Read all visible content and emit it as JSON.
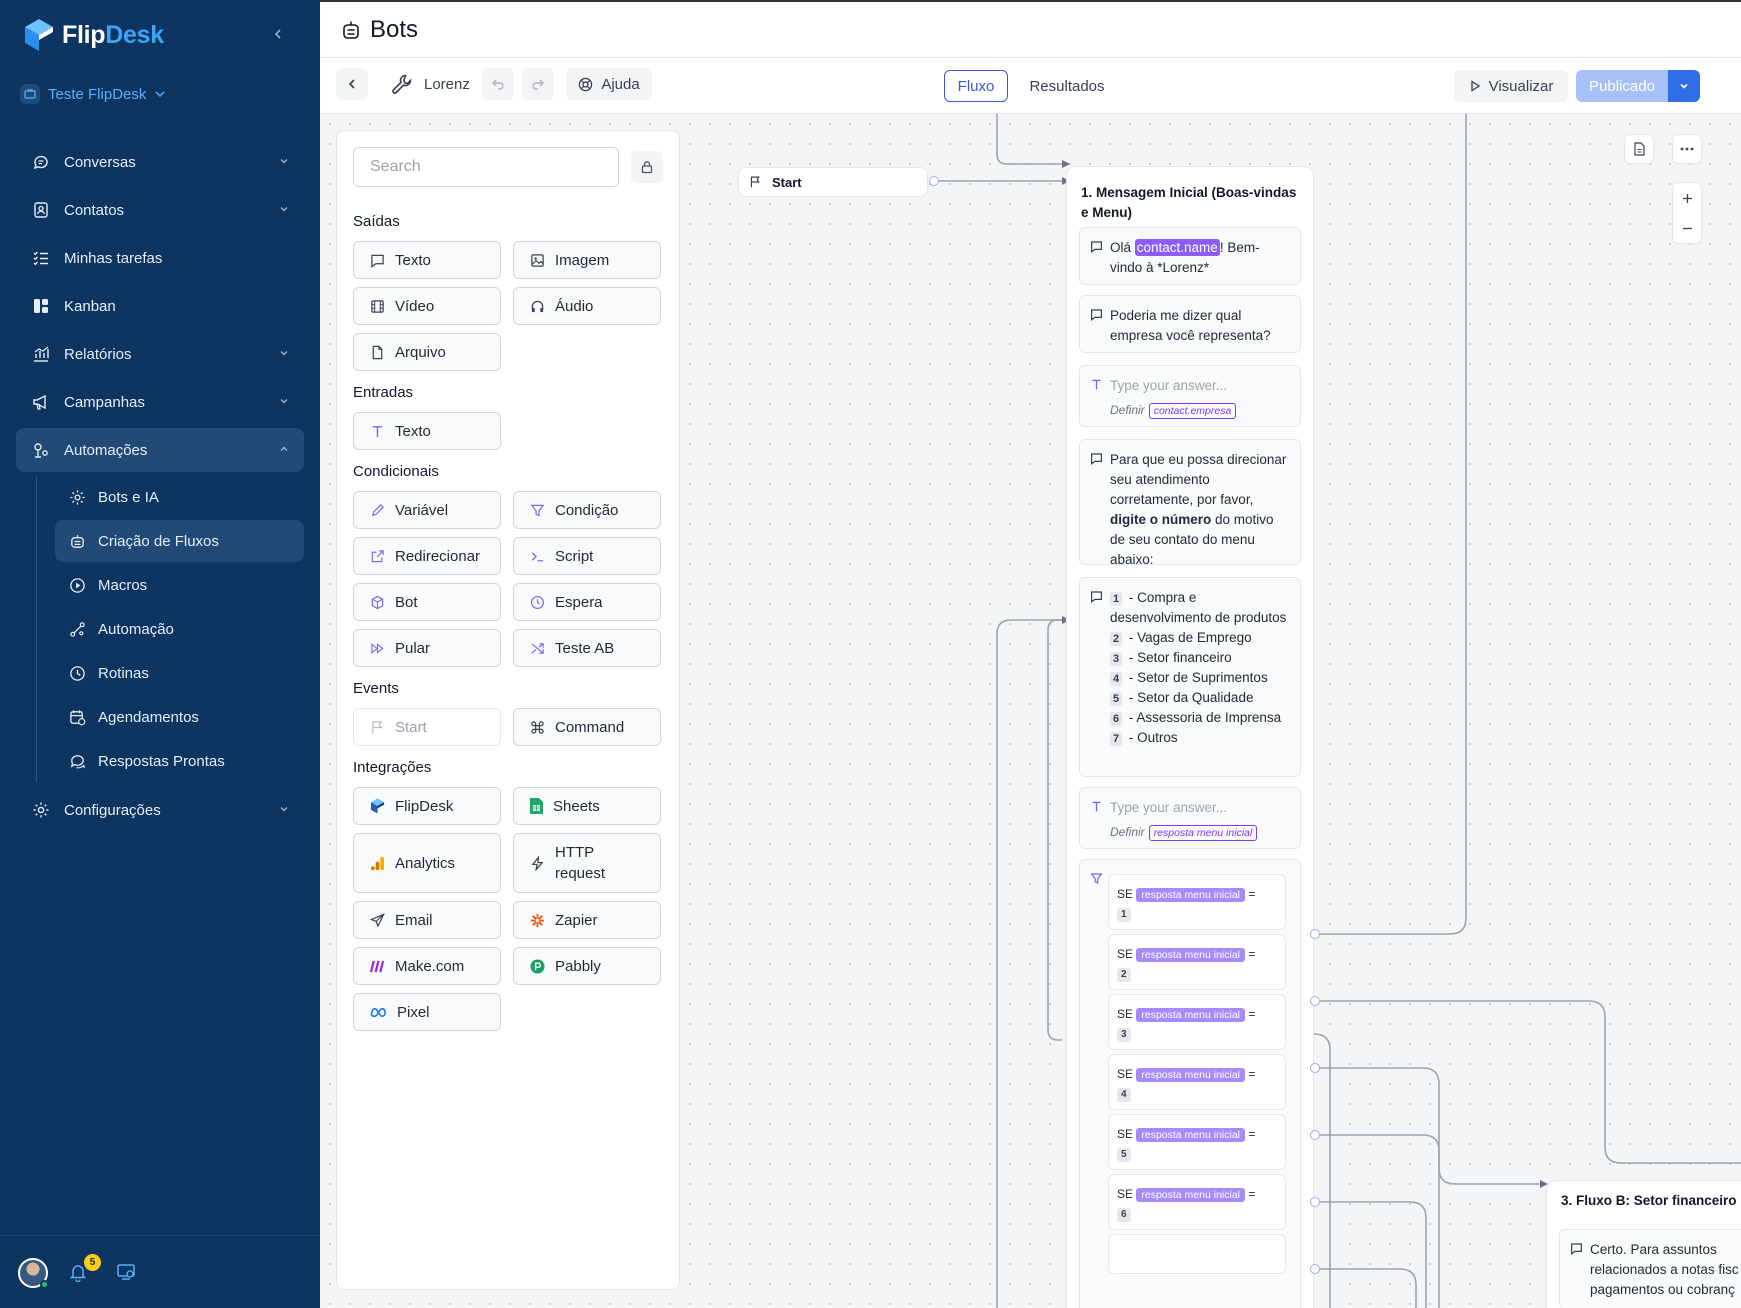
{
  "brand": {
    "name_part1": "Flip",
    "name_part2": "Desk"
  },
  "workspace": {
    "name": "Teste FlipDesk"
  },
  "nav": {
    "items": [
      {
        "label": "Conversas"
      },
      {
        "label": "Contatos"
      },
      {
        "label": "Minhas tarefas"
      },
      {
        "label": "Kanban"
      },
      {
        "label": "Relatórios"
      },
      {
        "label": "Campanhas"
      },
      {
        "label": "Automações"
      },
      {
        "label": "Configurações"
      }
    ],
    "sub_items": [
      {
        "label": "Bots e IA"
      },
      {
        "label": "Criação de Fluxos"
      },
      {
        "label": "Macros"
      },
      {
        "label": "Automação"
      },
      {
        "label": "Rotinas"
      },
      {
        "label": "Agendamentos"
      },
      {
        "label": "Respostas Prontas"
      }
    ]
  },
  "footer": {
    "notification_count": "5"
  },
  "header": {
    "title": "Bots"
  },
  "toolbar": {
    "bot_name": "Lorenz",
    "help_label": "Ajuda",
    "tab_flow": "Fluxo",
    "tab_results": "Resultados",
    "preview_label": "Visualizar",
    "publish_label": "Publicado"
  },
  "palette": {
    "search_placeholder": "Search",
    "sections": {
      "outputs": "Saídas",
      "inputs": "Entradas",
      "conditionals": "Condicionais",
      "events": "Events",
      "integrations": "Integrações"
    },
    "outputs": [
      "Texto",
      "Imagem",
      "Vídeo",
      "Áudio",
      "Arquivo"
    ],
    "inputs": [
      "Texto"
    ],
    "conditionals": [
      "Variável",
      "Condição",
      "Redirecionar",
      "Script",
      "Bot",
      "Espera",
      "Pular",
      "Teste AB"
    ],
    "events": [
      "Start",
      "Command"
    ],
    "integrations": [
      "FlipDesk",
      "Sheets",
      "Analytics",
      "HTTP request",
      "Email",
      "Zapier",
      "Make.com",
      "Pabbly",
      "Pixel"
    ]
  },
  "flow": {
    "start_label": "Start",
    "group1": {
      "title": "1. Mensagem Inicial (Boas-vindas e Menu)",
      "msg1_before": "Olá ",
      "msg1_var": "contact.name",
      "msg1_after": "! Bem-vindo à *Lorenz*",
      "msg2": "Poderia me dizer qual empresa você representa?",
      "input1_placeholder": "Type your answer...",
      "set_label": "Definir",
      "input1_var": "contact.empresa",
      "msg3_before": "Para que eu possa direcionar seu atendimento corretamente, por favor, ",
      "msg3_bold": "digite o número",
      "msg3_after": " do motivo de seu contato do menu abaixo:",
      "menu": [
        {
          "key": "1",
          "text": " - Compra e desenvolvimento de produtos"
        },
        {
          "key": "2",
          "text": " - Vagas de Emprego"
        },
        {
          "key": "3",
          "text": " - Setor financeiro"
        },
        {
          "key": "4",
          "text": " - Setor de Suprimentos"
        },
        {
          "key": "5",
          "text": " - Setor da Qualidade"
        },
        {
          "key": "6",
          "text": " - Assessoria de Imprensa"
        },
        {
          "key": "7",
          "text": " - Outros"
        }
      ],
      "input2_placeholder": "Type your answer...",
      "input2_var": "resposta menu inicial",
      "cond_prefix": "SE",
      "cond_var": "resposta menu inicial",
      "cond_op": "=",
      "conditions": [
        "1",
        "2",
        "3",
        "4",
        "5",
        "6"
      ]
    },
    "group2": {
      "title": "3. Fluxo B: Setor financeiro",
      "msg_lines": [
        "Certo. Para assuntos",
        "relacionados a notas fisc",
        "pagamentos ou cobranç"
      ]
    }
  },
  "colors": {
    "sidebar": "#0e3460",
    "accent": "#3b57d9",
    "variable": "#8b5cf6",
    "publish": "#a7c0f6"
  }
}
